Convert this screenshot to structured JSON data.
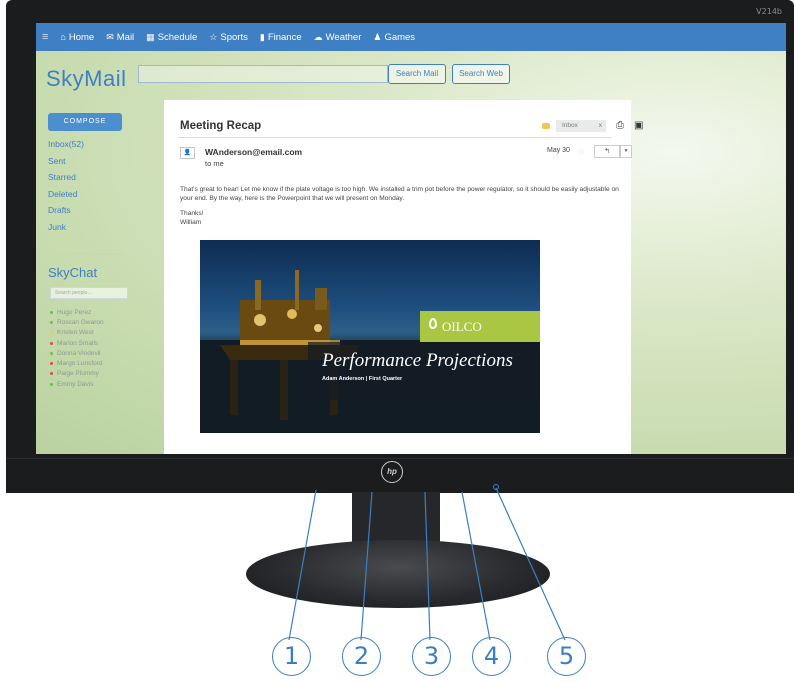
{
  "monitor": {
    "model": "V214b",
    "brand_logo": "hp"
  },
  "nav": {
    "items": [
      {
        "icon": "home-icon",
        "glyph": "⌂",
        "label": "Home"
      },
      {
        "icon": "mail-icon",
        "glyph": "✉",
        "label": "Mail"
      },
      {
        "icon": "calendar-icon",
        "glyph": "▦",
        "label": "Schedule"
      },
      {
        "icon": "trophy-icon",
        "glyph": "☆",
        "label": "Sports"
      },
      {
        "icon": "chart-icon",
        "glyph": "▮",
        "label": "Finance"
      },
      {
        "icon": "cloud-icon",
        "glyph": "☁",
        "label": "Weather"
      },
      {
        "icon": "pawn-icon",
        "glyph": "♟",
        "label": "Games"
      }
    ]
  },
  "app": {
    "logo": "SkyMail",
    "search_value": "",
    "search_mail_label": "Search Mail",
    "search_web_label": "Search Web"
  },
  "sidebar": {
    "compose_label": "COMPOSE",
    "folders": [
      "Inbox(52)",
      "Sent",
      "Starred",
      "Deleted",
      "Drafts",
      "Junk"
    ],
    "chat_title": "SkyChat",
    "chat_search_placeholder": "Search people...",
    "contacts": [
      {
        "name": "Hugo Perez",
        "status_color": "#6cc04a"
      },
      {
        "name": "Roscan Gwaron",
        "status_color": "#6cc04a"
      },
      {
        "name": "Kristen West",
        "status_color": "#f2c84a"
      },
      {
        "name": "Marion Smalls",
        "status_color": "#e04b4b"
      },
      {
        "name": "Donna Vindevil",
        "status_color": "#6cc04a"
      },
      {
        "name": "Margo Lunsford",
        "status_color": "#e04b4b"
      },
      {
        "name": "Paige Plummy",
        "status_color": "#e04b4b"
      },
      {
        "name": "Emmy Davis",
        "status_color": "#6cc04a"
      }
    ]
  },
  "email": {
    "subject": "Meeting Recap",
    "folder_chip": "Inbox",
    "folder_chip_close": "x",
    "sender": "WAnderson@email.com",
    "recipient": "to me",
    "date": "May 30",
    "body": "That's great to hear! Let me know if the plate voltage is too high. We installed a trim pot before the power regulator, so it should be easily adjustable on your end. By the way, here is the Powerpoint that we will present on Monday.",
    "closing": "Thanks!",
    "signature": "William",
    "attachment": {
      "brand": "OILCO",
      "title": "Performance Projections",
      "subtitle": "Adam Anderson   |   First Quarter"
    }
  },
  "callouts": [
    "1",
    "2",
    "3",
    "4",
    "5"
  ],
  "colors": {
    "accent": "#3f7fc4",
    "brand_green": "#a9c742"
  }
}
